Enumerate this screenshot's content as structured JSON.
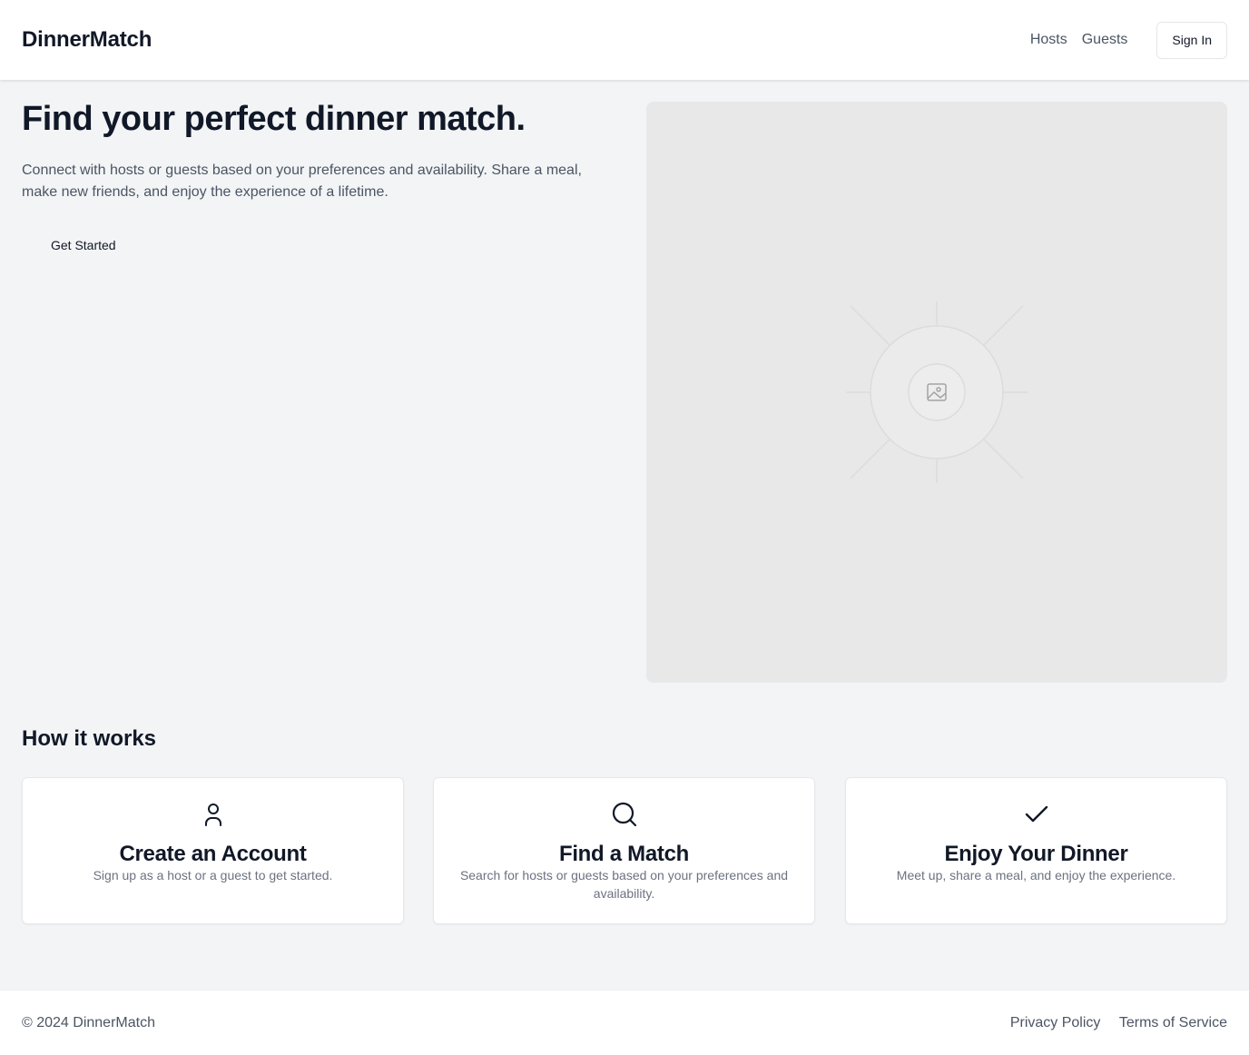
{
  "header": {
    "logo": "DinnerMatch",
    "nav": [
      "Hosts",
      "Guests"
    ],
    "signin_label": "Sign In"
  },
  "hero": {
    "title": "Find your perfect dinner match.",
    "description": "Connect with hosts or guests based on your preferences and availability. Share a meal, make new friends, and enjoy the experience of a lifetime.",
    "cta_label": "Get Started",
    "image_icon": "image-placeholder-icon"
  },
  "how_it_works": {
    "title": "How it works",
    "cards": [
      {
        "icon": "user-icon",
        "title": "Create an Account",
        "text": "Sign up as a host or a guest to get started."
      },
      {
        "icon": "search-icon",
        "title": "Find a Match",
        "text": "Search for hosts or guests based on your preferences and availability."
      },
      {
        "icon": "check-icon",
        "title": "Enjoy Your Dinner",
        "text": "Meet up, share a meal, and enjoy the experience."
      }
    ]
  },
  "footer": {
    "copyright": "© 2024 DinnerMatch",
    "links": [
      "Privacy Policy",
      "Terms of Service"
    ]
  },
  "colors": {
    "background": "#f2f4f6",
    "text_primary": "#111827",
    "text_secondary": "#4b5563",
    "placeholder": "#e8e8e8"
  }
}
